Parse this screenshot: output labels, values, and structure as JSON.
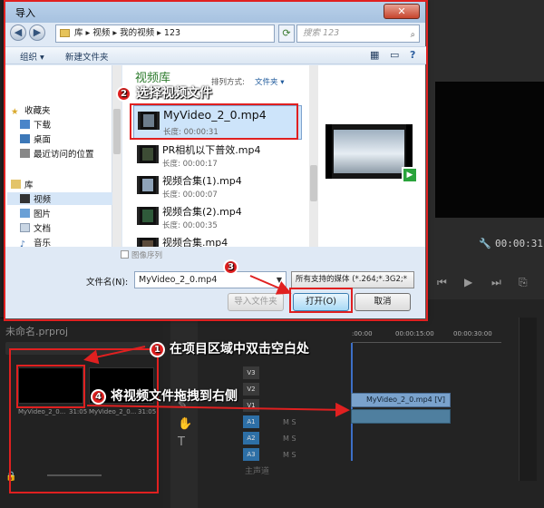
{
  "dialog": {
    "title": "导入",
    "close_label": "✕",
    "address": {
      "path": "库 ▸ 视频 ▸ 我的视频 ▸ 123",
      "search_placeholder": "搜索 123"
    },
    "toolbar": {
      "organize": "组织 ▾",
      "new_folder": "新建文件夹"
    },
    "sidebar": [
      {
        "label": "收藏夹",
        "icon": "star-icon"
      },
      {
        "label": "下载",
        "icon": "download-folder-icon"
      },
      {
        "label": "桌面",
        "icon": "desktop-icon"
      },
      {
        "label": "最近访问的位置",
        "icon": "recent-places-icon"
      },
      {
        "label": "库",
        "icon": "library-icon"
      },
      {
        "label": "视频",
        "icon": "video-library-icon"
      },
      {
        "label": "图片",
        "icon": "pictures-library-icon"
      },
      {
        "label": "文档",
        "icon": "documents-library-icon"
      },
      {
        "label": "音乐",
        "icon": "music-library-icon"
      }
    ],
    "library_title": "视频库",
    "arrange_label": "排列方式:",
    "arrange_value": "文件夹 ▾",
    "files": [
      {
        "name": "MyVideo_2_0.mp4",
        "duration": "长度: 00:00:31"
      },
      {
        "name": "PR相机以下普效.mp4",
        "duration": "长度: 00:00:17"
      },
      {
        "name": "视频合集(1).mp4",
        "duration": "长度: 00:00:07"
      },
      {
        "name": "视频合集(2).mp4",
        "duration": "长度: 00:00:35"
      },
      {
        "name": "视频合集.mp4",
        "duration": ""
      }
    ],
    "image_sequence": "图像序列",
    "filename_label": "文件名(N):",
    "filename_value": "MyVideo_2_0.mp4",
    "filetype_value": "所有支持的媒体 (*.264;*.3G2;*",
    "import_folder": "导入文件夹",
    "open": "打开(O)",
    "cancel": "取消"
  },
  "annotations": {
    "step1": {
      "num": "1",
      "text": "在项目区域中双击空白处"
    },
    "step2": {
      "num": "2",
      "text": "选择视频文件"
    },
    "step3": {
      "num": "3",
      "text": ""
    },
    "step4": {
      "num": "4",
      "text": "将视频文件拖拽到右侧"
    },
    "accent": "#e02020"
  },
  "premiere": {
    "project_title": "未命名.prproj",
    "thumb_caption_1": "MyVideo_2_0...",
    "thumb_caption_2": "MyVideo_2_0...",
    "thumb_dur_1": "31:05",
    "thumb_dur_2": "31:05",
    "ruler": [
      ":00:00",
      "00:00:15:00",
      "00:00:30:00"
    ],
    "tracks_v": [
      "V3",
      "V2",
      "V1"
    ],
    "tracks_a": [
      "A1",
      "A2",
      "A3"
    ],
    "track_ms": "M S",
    "master": "主声道",
    "clip_video": "MyVideo_2_0.mp4 [V]",
    "clip_audio": "",
    "right_time": "00:00:31",
    "timeline_time": "00:00:00:00"
  }
}
